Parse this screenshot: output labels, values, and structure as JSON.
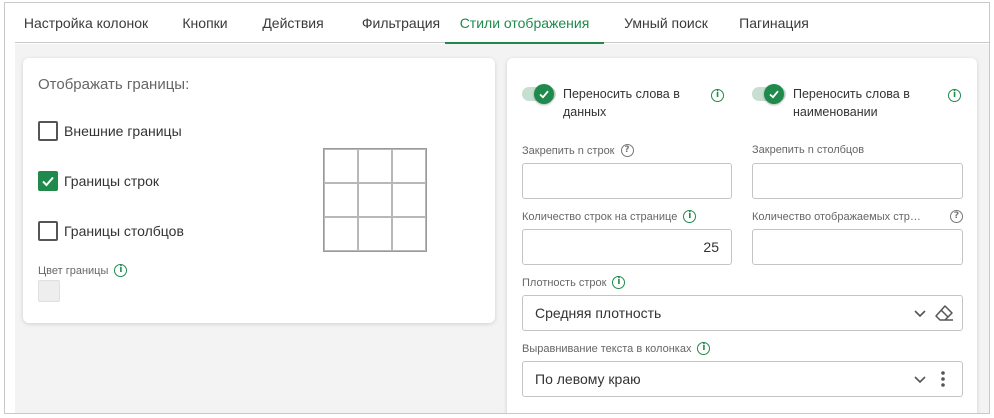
{
  "tabs": [
    {
      "label": "Настройка колонок",
      "active": false
    },
    {
      "label": "Кнопки",
      "active": false
    },
    {
      "label": "Действия",
      "active": false
    },
    {
      "label": "Фильтрация",
      "active": false
    },
    {
      "label": "Стили отображения",
      "active": true
    },
    {
      "label": "Умный поиск",
      "active": false
    },
    {
      "label": "Пагинация",
      "active": false
    }
  ],
  "borders": {
    "title": "Отображать границы:",
    "outer": {
      "label": "Внешние границы",
      "checked": false
    },
    "rows": {
      "label": "Границы строк",
      "checked": true
    },
    "cols": {
      "label": "Границы столбцов",
      "checked": false
    },
    "color_label": "Цвет границы",
    "color_value": "#eeeeee"
  },
  "settings": {
    "wrap_data": {
      "label": "Переносить слова в данных",
      "on": true
    },
    "wrap_names": {
      "label": "Переносить слова в наименовании",
      "on": true
    },
    "freeze_rows": {
      "label": "Закрепить n строк",
      "value": ""
    },
    "freeze_cols": {
      "label": "Закрепить n столбцов",
      "value": ""
    },
    "rows_per_page": {
      "label": "Количество строк на странице",
      "value": "25"
    },
    "displayed_rows": {
      "label": "Количество отображаемых стр…",
      "value": ""
    },
    "density": {
      "label": "Плотность строк",
      "value": "Средняя плотность"
    },
    "alignment": {
      "label": "Выравнивание текста в колонках",
      "value": "По левому краю"
    }
  },
  "colors": {
    "accent": "#1f8a4c",
    "toggle_track": "#c7dfd0"
  }
}
